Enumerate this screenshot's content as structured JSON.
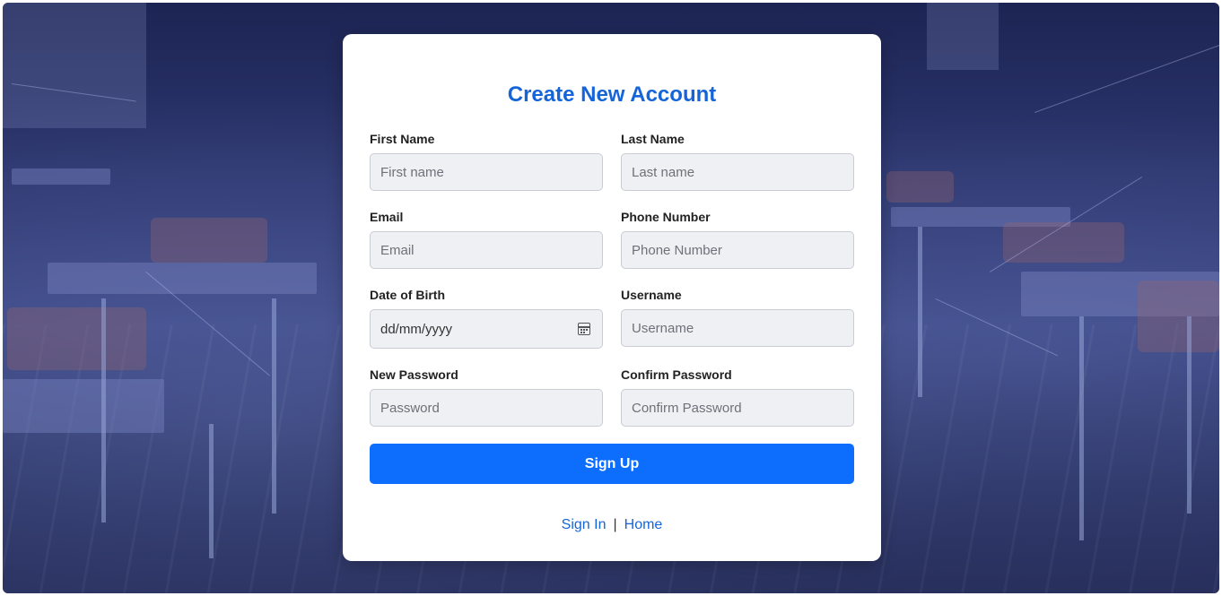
{
  "form": {
    "title": "Create New Account",
    "first_name": {
      "label": "First Name",
      "placeholder": "First name"
    },
    "last_name": {
      "label": "Last Name",
      "placeholder": "Last name"
    },
    "email": {
      "label": "Email",
      "placeholder": "Email"
    },
    "phone": {
      "label": "Phone Number",
      "placeholder": "Phone Number"
    },
    "dob": {
      "label": "Date of Birth",
      "placeholder": "dd/mm/yyyy"
    },
    "username": {
      "label": "Username",
      "placeholder": "Username"
    },
    "new_password": {
      "label": "New Password",
      "placeholder": "Password"
    },
    "confirm_password": {
      "label": "Confirm Password",
      "placeholder": "Confirm Password"
    },
    "submit_label": "Sign Up",
    "links": {
      "sign_in": "Sign In",
      "separator": "|",
      "home": "Home"
    }
  },
  "colors": {
    "accent": "#0d6efd",
    "title": "#1565d8",
    "background": "#2e3870"
  },
  "icons": {
    "date_picker": "calendar-icon"
  }
}
